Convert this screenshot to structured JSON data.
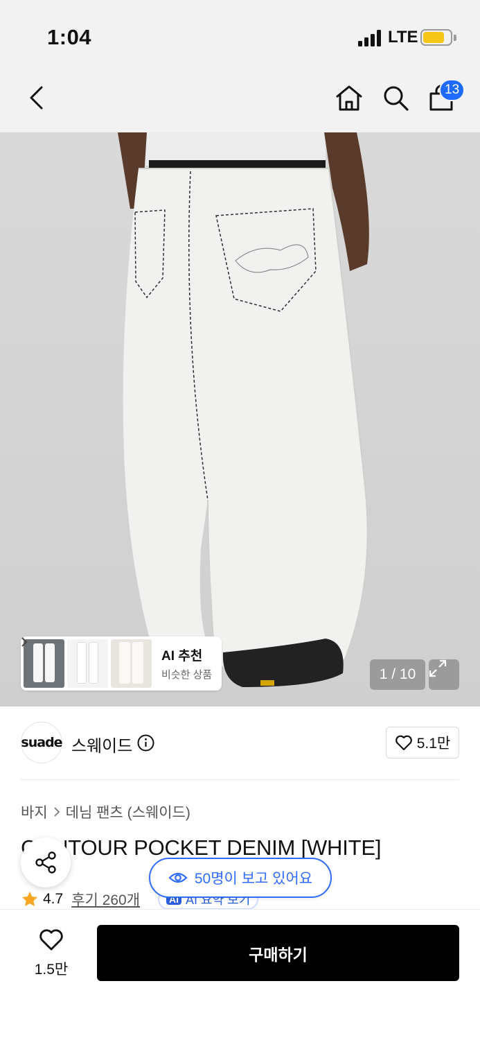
{
  "status_bar": {
    "time": "1:04",
    "network": "LTE",
    "battery_color": "#f5c518"
  },
  "nav": {
    "back_icon": "chevron-left-icon",
    "home_icon": "home-icon",
    "search_icon": "search-icon",
    "cart_icon": "shopping-bag-icon",
    "cart_count": "13",
    "badge_color": "#1f6bff"
  },
  "gallery": {
    "counter": "1 / 10",
    "expand_icon": "expand-icon",
    "ai_recommend": {
      "title": "AI 추천",
      "subtitle": "비슷한 상품"
    }
  },
  "brand": {
    "logo_text": "suade",
    "name": "스웨이드",
    "info_icon": "info-icon",
    "likes": "5.1만"
  },
  "product": {
    "breadcrumb": [
      "바지",
      "데님 팬츠 (스웨이드)"
    ],
    "title": "CONTOUR POCKET DENIM [WHITE]",
    "rating": "4.7",
    "reviews": "후기 260개",
    "ai_summary_badge": "AI",
    "ai_summary": "AI 요약 보기"
  },
  "overlays": {
    "share_icon": "share-icon",
    "viewers": "50명이 보고 있어요",
    "accent": "#2f6bff"
  },
  "bottom_bar": {
    "wish_count": "1.5만",
    "buy_label": "구매하기"
  }
}
